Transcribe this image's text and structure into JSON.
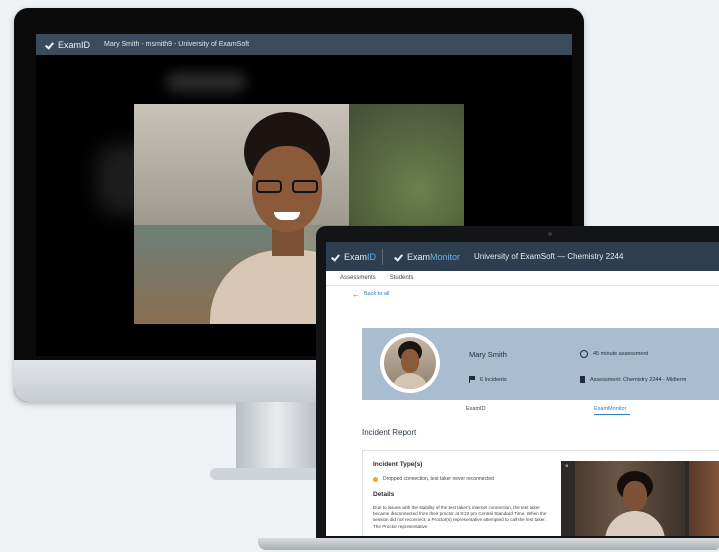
{
  "monitor": {
    "brand": "ExamID",
    "user_label": "Mary Smith - msmith9 - University of ExamSoft"
  },
  "laptop": {
    "brand_examid_prefix": "Exam",
    "brand_examid_accent": "ID",
    "brand_monitor_prefix": "Exam",
    "brand_monitor_accent": "Monitor",
    "course": "University of ExamSoft  —  Chemistry 2244",
    "tabs": [
      "Assessments",
      "Students"
    ],
    "back_label": "Back to all",
    "student": {
      "name": "Mary Smith",
      "incidents": "6 Incidents",
      "duration": "45 minute assessment",
      "assessment": "Assessment: Chemistry 2244 - Midterm"
    },
    "subtabs": [
      "ExamID",
      "ExamMonitor"
    ],
    "section_title": "Incident Report",
    "report": {
      "types_heading": "Incident Type(s)",
      "type_item": "Dropped connection, test taker never reconnected",
      "details_heading": "Details",
      "details_text": "Due to issues with the stability of the test taker's internet connection, the test taker became disconnected from their proctor at 8:22 pm Central Standard Time. When the session did not reconnect, a Proctor(s) representative attempted to call the test taker. The Proctor representative"
    },
    "close_label": "×"
  },
  "colors": {
    "topbar": "#2c3e50",
    "accent": "#6fb1e4",
    "card": "#a8bdd0",
    "link": "#2f7fc1",
    "warning_dot": "#f5a623"
  }
}
